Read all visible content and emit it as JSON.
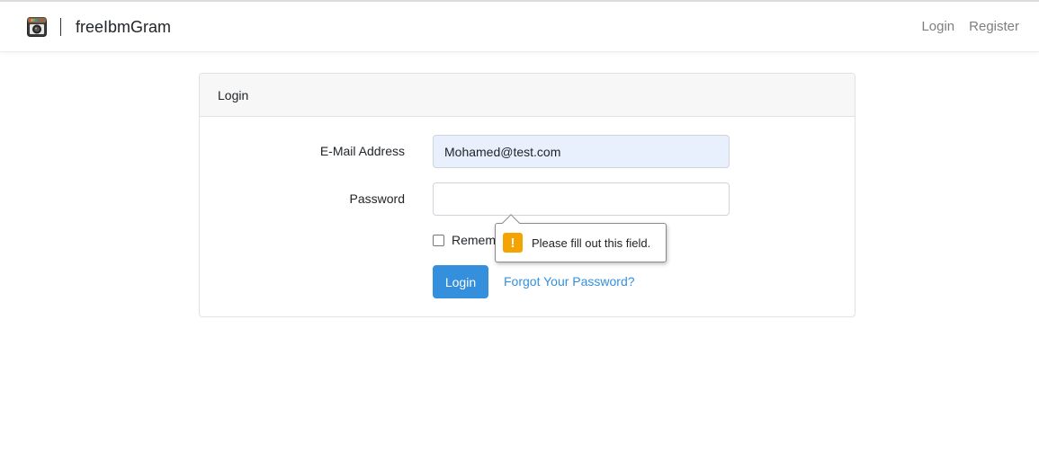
{
  "navbar": {
    "brand_icon": "camera-icon",
    "brand_name": "freeIbmGram",
    "links": [
      {
        "label": "Login"
      },
      {
        "label": "Register"
      }
    ]
  },
  "login_card": {
    "title": "Login",
    "email_label": "E-Mail Address",
    "email_value": "Mohamed@test.com",
    "password_label": "Password",
    "password_value": "",
    "remember_label": "Remember Me",
    "remember_checked": false,
    "submit_label": "Login",
    "forgot_label": "Forgot Your Password?"
  },
  "validation_tooltip": {
    "icon": "warning-icon",
    "icon_glyph": "!",
    "message": "Please fill out this field."
  },
  "colors": {
    "primary": "#3490dc",
    "autofill_bg": "#e8f0fe",
    "warning": "#f5a300",
    "nav_link": "#7f7f7f"
  }
}
